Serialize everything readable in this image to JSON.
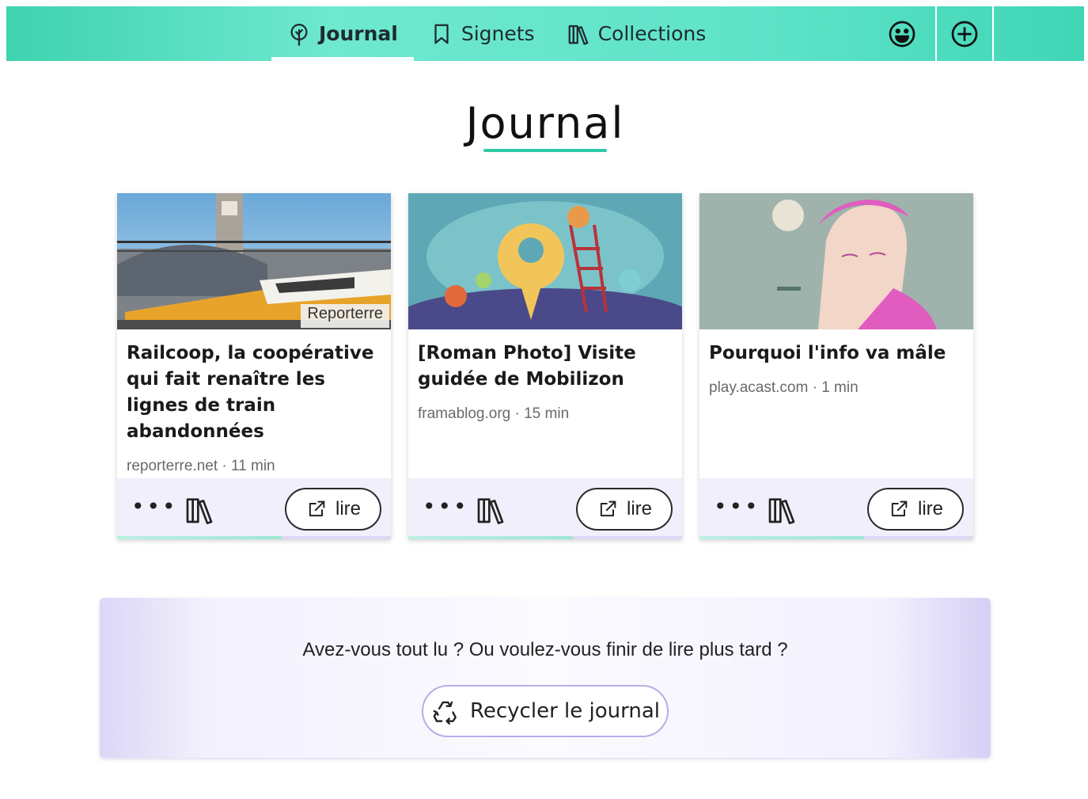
{
  "nav": {
    "items": [
      {
        "label": "Journal",
        "icon": "tree-icon",
        "active": true
      },
      {
        "label": "Signets",
        "icon": "bookmark-icon",
        "active": false
      },
      {
        "label": "Collections",
        "icon": "books-icon",
        "active": false
      }
    ],
    "account_icon": "smiley-icon",
    "add_icon": "plus-circle-icon"
  },
  "page": {
    "title": "Journal"
  },
  "cards": [
    {
      "title": "Railcoop, la coopérative qui fait renaître les lignes de train abandonnées",
      "meta": "reporterre.net · 11 min",
      "image_logo": "Reporterre",
      "more_label": "•••",
      "read_label": "lire"
    },
    {
      "title": "[Roman Photo] Visite guidée de Mobilizon",
      "meta": "framablog.org · 15 min",
      "more_label": "•••",
      "read_label": "lire"
    },
    {
      "title": "Pourquoi l'info va mâle",
      "meta": "play.acast.com · 1 min",
      "more_label": "•••",
      "read_label": "lire"
    }
  ],
  "recycle": {
    "text": "Avez-vous tout lu ? Ou voulez-vous finir de lire plus tard ?",
    "button_label": "Recycler le journal"
  },
  "colors": {
    "accent": "#3fd3b0",
    "underline": "#2fc9a7",
    "footer_bg": "#f1effb",
    "panel_border": "#b7aee8"
  }
}
